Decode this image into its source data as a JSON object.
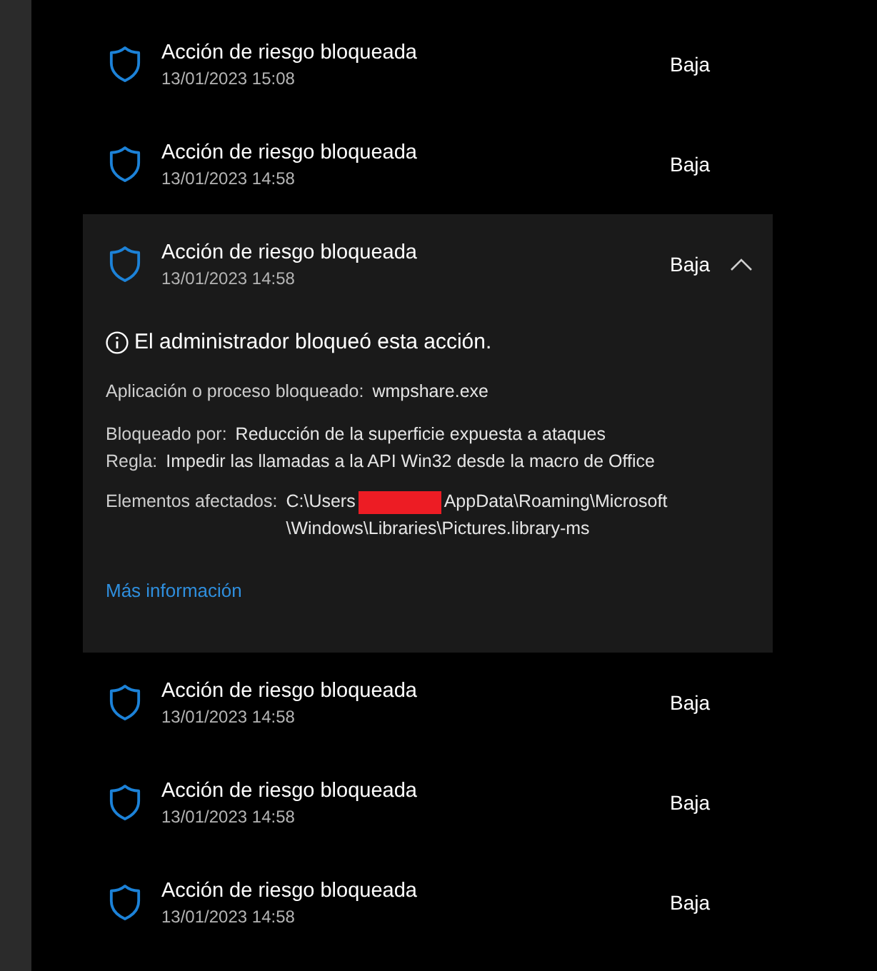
{
  "alerts": [
    {
      "title": "Acción de riesgo bloqueada",
      "date": "13/01/2023 15:08",
      "severity": "Baja",
      "expanded": false
    },
    {
      "title": "Acción de riesgo bloqueada",
      "date": "13/01/2023 14:58",
      "severity": "Baja",
      "expanded": false
    },
    {
      "title": "Acción de riesgo bloqueada",
      "date": "13/01/2023 14:58",
      "severity": "Baja",
      "expanded": true,
      "details": {
        "notice": "El administrador bloqueó esta acción.",
        "field_groups": [
          [
            {
              "label": "Aplicación o proceso bloqueado:",
              "lines": [
                [
                  {
                    "kind": "text",
                    "text": "wmpshare.exe"
                  }
                ]
              ]
            }
          ],
          [
            {
              "label": "Bloqueado por:",
              "lines": [
                [
                  {
                    "kind": "text",
                    "text": "Reducción de la superficie expuesta a ataques"
                  }
                ]
              ]
            },
            {
              "label": "Regla:",
              "lines": [
                [
                  {
                    "kind": "text",
                    "text": "Impedir las llamadas a la API Win32 desde la macro de Office"
                  }
                ]
              ]
            }
          ],
          [
            {
              "label": "Elementos afectados:",
              "lines": [
                [
                  {
                    "kind": "text",
                    "text": "C:\\Users"
                  },
                  {
                    "kind": "redaction"
                  },
                  {
                    "kind": "text",
                    "text": "AppData\\Roaming\\Microsoft"
                  }
                ],
                [
                  {
                    "kind": "text",
                    "text": "\\Windows\\Libraries\\Pictures.library-ms"
                  }
                ]
              ]
            }
          ]
        ],
        "link": "Más información"
      }
    },
    {
      "title": "Acción de riesgo bloqueada",
      "date": "13/01/2023 14:58",
      "severity": "Baja",
      "expanded": false
    },
    {
      "title": "Acción de riesgo bloqueada",
      "date": "13/01/2023 14:58",
      "severity": "Baja",
      "expanded": false
    },
    {
      "title": "Acción de riesgo bloqueada",
      "date": "13/01/2023 14:58",
      "severity": "Baja",
      "expanded": false
    }
  ]
}
